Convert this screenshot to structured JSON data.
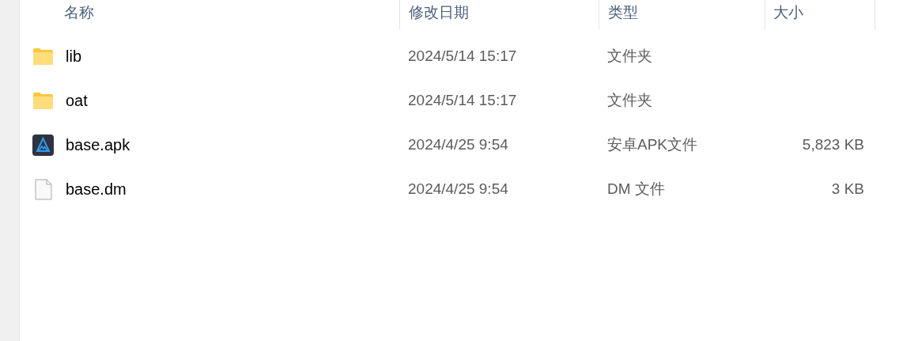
{
  "columns": [
    "名称",
    "修改日期",
    "类型",
    "大小"
  ],
  "rows": [
    {
      "kind": "folder",
      "name": "lib",
      "modified": "2024/5/14 15:17",
      "type": "文件夹"
    },
    {
      "kind": "folder",
      "name": "oat",
      "modified": "2024/5/14 15:17",
      "type": "文件夹"
    },
    {
      "kind": "apk",
      "name": "base.apk",
      "modified": "2024/4/25 9:54",
      "type": "安卓APK文件",
      "size": "5,823 KB"
    },
    {
      "kind": "file",
      "name": "base.dm",
      "modified": "2024/4/25 9:54",
      "type": "DM 文件",
      "size": "3 KB"
    }
  ]
}
